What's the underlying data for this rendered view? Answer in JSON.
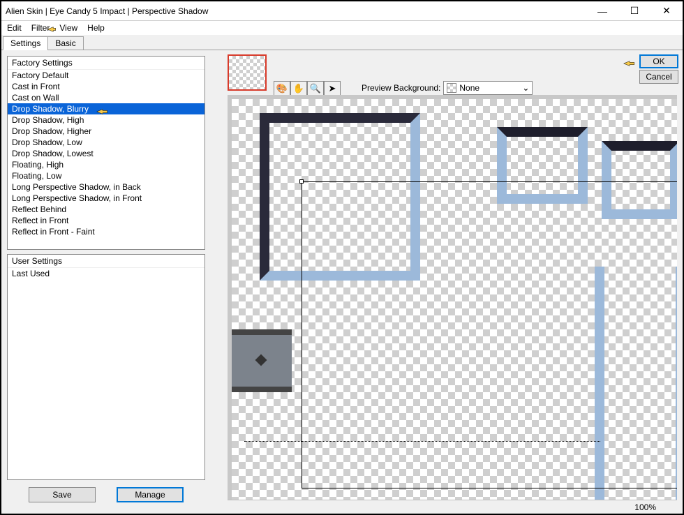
{
  "window": {
    "title": "Alien Skin | Eye Candy 5 Impact | Perspective Shadow"
  },
  "menu": {
    "edit": "Edit",
    "filter": "Filter",
    "view": "View",
    "help": "Help"
  },
  "tabs": {
    "settings": "Settings",
    "basic": "Basic"
  },
  "factory": {
    "header": "Factory Settings",
    "items": [
      "Factory Default",
      "Cast in Front",
      "Cast on Wall",
      "Drop Shadow, Blurry",
      "Drop Shadow, High",
      "Drop Shadow, Higher",
      "Drop Shadow, Low",
      "Drop Shadow, Lowest",
      "Floating, High",
      "Floating, Low",
      "Long Perspective Shadow, in Back",
      "Long Perspective Shadow, in Front",
      "Reflect Behind",
      "Reflect in Front",
      "Reflect in Front - Faint"
    ],
    "selected_index": 3
  },
  "user": {
    "header": "User Settings",
    "items": [
      "Last Used"
    ]
  },
  "buttons": {
    "save": "Save",
    "manage": "Manage",
    "ok": "OK",
    "cancel": "Cancel"
  },
  "preview": {
    "label": "Preview Background:",
    "value": "None"
  },
  "zoom": "100%"
}
